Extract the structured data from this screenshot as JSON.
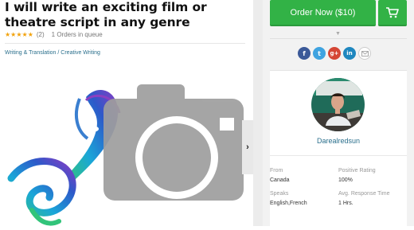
{
  "gig": {
    "title": "I will write an exciting film or theatre script in any genre",
    "stars": "★★★★★",
    "review_count": "(2)",
    "queue": "1 Orders in queue",
    "category": "Writing & Translation / Creative Writing",
    "rating_value": 5,
    "rating_max": 5
  },
  "gallery": {
    "next_glyph": "›"
  },
  "order": {
    "label": "Order Now ($10)"
  },
  "colors": {
    "brand_green": "#32b246",
    "link_blue": "#2a6f8c",
    "star_gold": "#f2a20c",
    "facebook": "#3b5998",
    "twitter": "#3fa3e0",
    "googleplus": "#d54635",
    "linkedin": "#1f87bf"
  },
  "share": {
    "icons": [
      "facebook-icon",
      "twitter-icon",
      "google-plus-icon",
      "linkedin-icon",
      "email-icon"
    ],
    "facebook_glyph": "f",
    "twitter_glyph": "t",
    "google_glyph": "g+",
    "linkedin_glyph": "in"
  },
  "seller": {
    "name": "Darealredsun",
    "from_label": "From",
    "from_value": "Canada",
    "positive_label": "Positive Rating",
    "positive_value": "100%",
    "speaks_label": "Speaks",
    "speaks_value": "English,French",
    "response_label": "Avg. Response Time",
    "response_value": "1 Hrs."
  }
}
